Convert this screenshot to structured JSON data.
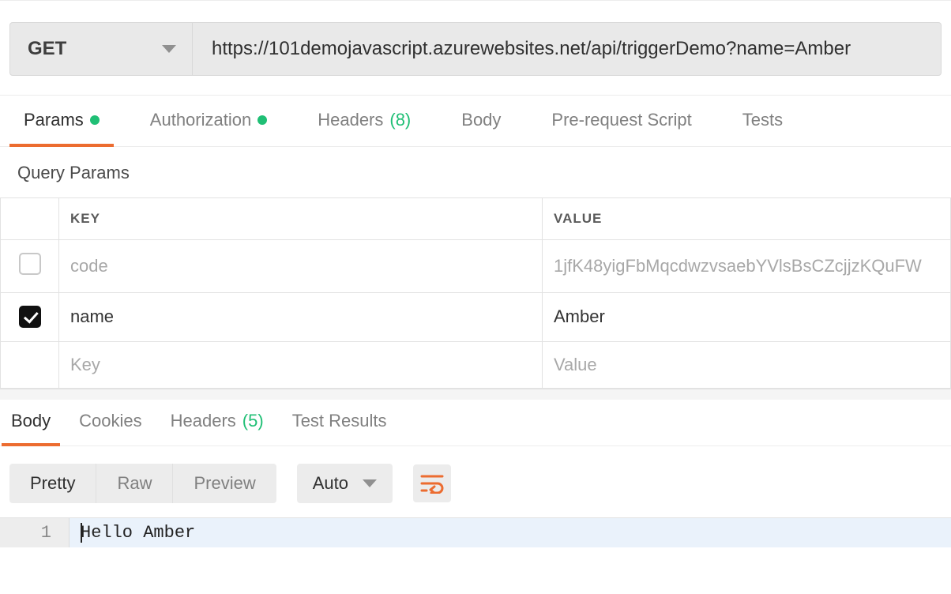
{
  "request": {
    "method": "GET",
    "url": "https://101demojavascript.azurewebsites.net/api/triggerDemo?name=Amber"
  },
  "req_tabs": {
    "params": "Params",
    "params_has_dot": true,
    "authorization": "Authorization",
    "authorization_has_dot": true,
    "headers": "Headers",
    "headers_count": "(8)",
    "body": "Body",
    "prerequest": "Pre-request Script",
    "tests": "Tests"
  },
  "section": {
    "query_params": "Query Params"
  },
  "table": {
    "header_key": "KEY",
    "header_value": "VALUE",
    "rows": [
      {
        "enabled": false,
        "key": "code",
        "value": "1jfK48yigFbMqcdwzvsaebYVlsBsCZcjjzKQuFW"
      },
      {
        "enabled": true,
        "key": "name",
        "value": "Amber"
      }
    ],
    "placeholder_key": "Key",
    "placeholder_value": "Value"
  },
  "resp_tabs": {
    "body": "Body",
    "cookies": "Cookies",
    "headers": "Headers",
    "headers_count": "(5)",
    "test_results": "Test Results"
  },
  "resp_toolbar": {
    "pretty": "Pretty",
    "raw": "Raw",
    "preview": "Preview",
    "format": "Auto"
  },
  "response": {
    "line_no": "1",
    "text": "Hello Amber"
  }
}
